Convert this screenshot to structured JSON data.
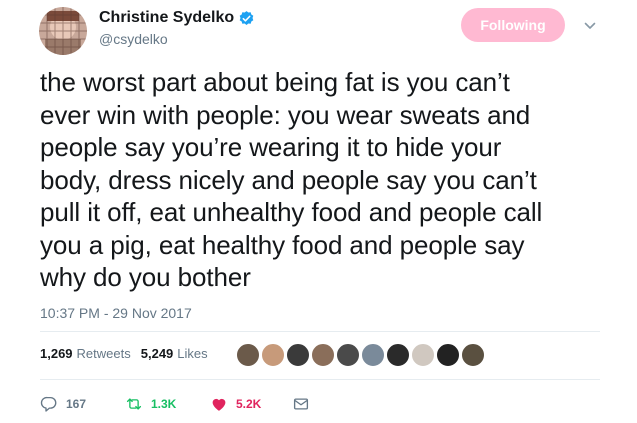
{
  "author": {
    "display_name": "Christine Sydelko",
    "handle": "@csydelko",
    "avatar_icon": "avatar-photo",
    "verified_icon": "verified-badge-icon"
  },
  "follow_button": {
    "label": "Following",
    "color": "#ffb9d2"
  },
  "menu": {
    "icon": "chevron-down-icon"
  },
  "tweet": {
    "text_lines": [
      "the worst part about being fat is you can’t",
      "ever win with people: you wear sweats and",
      "people say you’re wearing it to hide your",
      "body, dress nicely and people say you can’t",
      "pull it off, eat unhealthy food and people call",
      "you a pig, eat healthy food and people say",
      "why do you bother"
    ],
    "timestamp": "10:37 PM - 29 Nov 2017"
  },
  "stats": {
    "retweets_count": "1,269",
    "retweets_label": "Retweets",
    "likes_count": "5,249",
    "likes_label": "Likes"
  },
  "liker_avatars": [
    {
      "color": "#6b5a4a"
    },
    {
      "color": "#c79a7a"
    },
    {
      "color": "#3a3a3a"
    },
    {
      "color": "#8a6e5a"
    },
    {
      "color": "#4a4a4a"
    },
    {
      "color": "#7a8a9a"
    },
    {
      "color": "#2a2a2a"
    },
    {
      "color": "#d0c8c0"
    },
    {
      "color": "#222222"
    },
    {
      "color": "#5a5040"
    }
  ],
  "actions": {
    "reply": {
      "icon": "reply-icon",
      "count": "167",
      "color": "#657786"
    },
    "retweet": {
      "icon": "retweet-icon",
      "count": "1.3K",
      "color": "#17bf63"
    },
    "like": {
      "icon": "heart-icon",
      "count": "5.2K",
      "color": "#e0245e"
    },
    "dm": {
      "icon": "envelope-icon",
      "color": "#657786"
    }
  }
}
